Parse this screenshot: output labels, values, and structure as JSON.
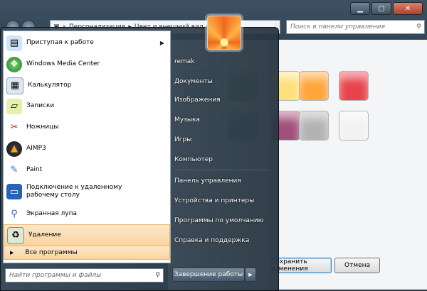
{
  "window": {
    "address_crumbs": [
      "Персонализация",
      "Цвет и внешний вид окна"
    ],
    "search_placeholder": "Поиск в панели управления",
    "save_label": "Сохранить изменения",
    "cancel_label": "Отмена",
    "swatch_colors": [
      "#9ec7e8",
      "#7fbf6a",
      "#ffe07a",
      "#ffa53a",
      "#e8424a",
      "#8fa3c7",
      "#a0507a",
      "#b3b3b3",
      "#f2f2f2"
    ]
  },
  "start_menu": {
    "programs": [
      {
        "label": "Приступая к работе",
        "icon": "getting-started-icon",
        "submenu": true
      },
      {
        "label": "Windows Media Center",
        "icon": "media-center-icon"
      },
      {
        "label": "Калькулятор",
        "icon": "calculator-icon"
      },
      {
        "label": "Записки",
        "icon": "sticky-notes-icon"
      },
      {
        "label": "Ножницы",
        "icon": "snipping-tool-icon"
      },
      {
        "label": "AIMP3",
        "icon": "aimp-icon"
      },
      {
        "label": "Paint",
        "icon": "paint-icon"
      },
      {
        "label": "Подключение к удаленному рабочему столу",
        "icon": "remote-desktop-icon"
      },
      {
        "label": "Экранная лупа",
        "icon": "magnifier-icon"
      },
      {
        "label": "Удаление",
        "icon": "recycle-bin-icon",
        "highlighted": true
      }
    ],
    "all_programs": "Все программы",
    "search_placeholder": "Найти программы и файлы",
    "right_items": [
      "remak",
      "Документы",
      "Изображения",
      "Музыка",
      "Игры",
      "Компьютер",
      "Панель управления",
      "Устройства и принтеры",
      "Программы по умолчанию",
      "Справка и поддержка"
    ],
    "shutdown_label": "Завершение работы"
  }
}
